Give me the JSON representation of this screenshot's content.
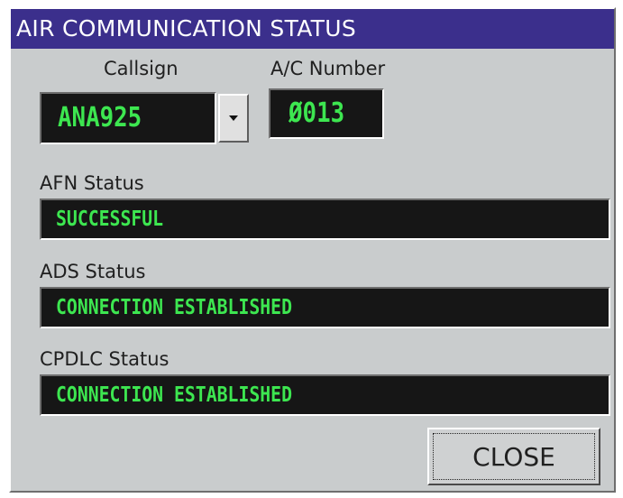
{
  "window": {
    "title": "AIR COMMUNICATION STATUS"
  },
  "callsign": {
    "label": "Callsign",
    "value": "ANA925",
    "dropdown_icon": "chevron-down-icon"
  },
  "aircraft": {
    "label": "A/C Number",
    "value": "Ø013"
  },
  "afn": {
    "label": "AFN Status",
    "value": "SUCCESSFUL"
  },
  "ads": {
    "label": "ADS Status",
    "value": "CONNECTION ESTABLISHED"
  },
  "cpdlc": {
    "label": "CPDLC Status",
    "value": "CONNECTION ESTABLISHED"
  },
  "actions": {
    "close_label": "CLOSE"
  },
  "colors": {
    "title_bar": "#3b2f8c",
    "panel": "#c9cccd",
    "display_bg": "#161616",
    "display_text": "#3de650"
  }
}
